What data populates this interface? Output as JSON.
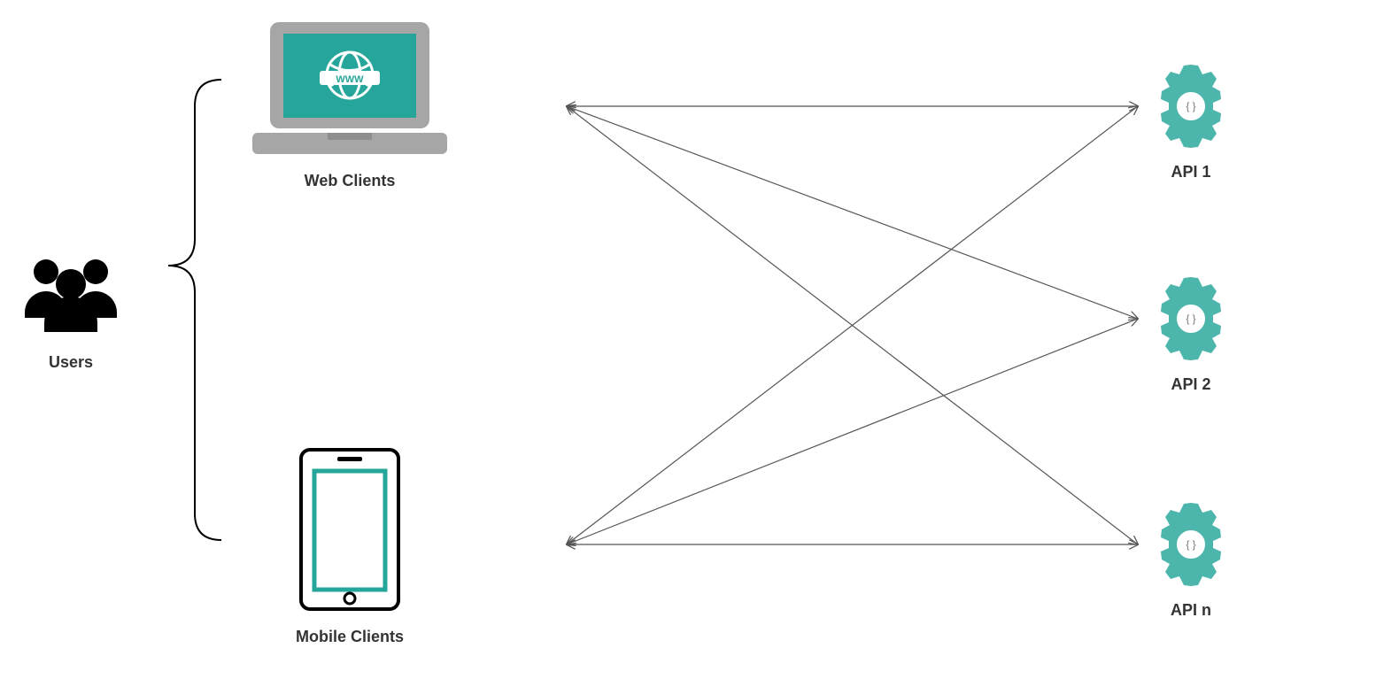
{
  "users": {
    "label": "Users"
  },
  "clients": {
    "web": {
      "label": "Web Clients",
      "www_text": "WWW"
    },
    "mobile": {
      "label": "Mobile Clients"
    }
  },
  "apis": [
    {
      "label": "API 1",
      "glyph": "{ }"
    },
    {
      "label": "API 2",
      "glyph": "{ }"
    },
    {
      "label": "API n",
      "glyph": "{ }"
    }
  ],
  "colors": {
    "teal1": "#4DB6AC",
    "teal2": "#26A69A",
    "gray": "#A6A6A6",
    "black": "#000000",
    "arrow": "#555555"
  }
}
